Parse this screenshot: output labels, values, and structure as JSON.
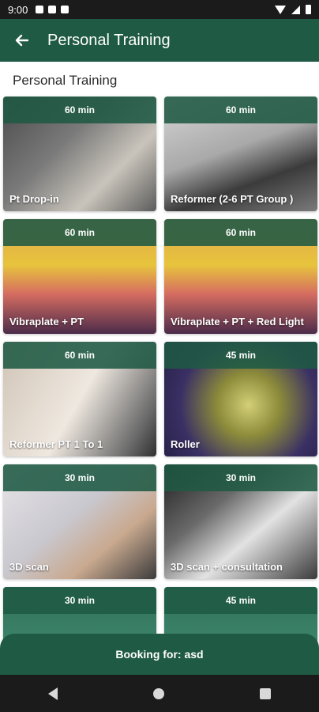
{
  "status_bar": {
    "time": "9:00"
  },
  "app_bar": {
    "title": "Personal Training",
    "back_icon": "arrow-left-icon"
  },
  "section": {
    "title": "Personal Training"
  },
  "cards": [
    {
      "duration": "60 min",
      "title": "Pt Drop-in"
    },
    {
      "duration": "60 min",
      "title": "Reformer  (2-6 PT Group )"
    },
    {
      "duration": "60 min",
      "title": "Vibraplate + PT"
    },
    {
      "duration": "60 min",
      "title": "Vibraplate + PT + Red Light"
    },
    {
      "duration": "60 min",
      "title": "Reformer PT 1 To 1"
    },
    {
      "duration": "45 min",
      "title": "Roller"
    },
    {
      "duration": "30 min",
      "title": "3D scan"
    },
    {
      "duration": "30 min",
      "title": "3D scan + consultation"
    },
    {
      "duration": "30 min",
      "title": ""
    },
    {
      "duration": "45 min",
      "title": ""
    }
  ],
  "booking": {
    "label": "Booking for: asd"
  },
  "colors": {
    "primary": "#1f5a44",
    "system_bar": "#1b1b1b"
  }
}
